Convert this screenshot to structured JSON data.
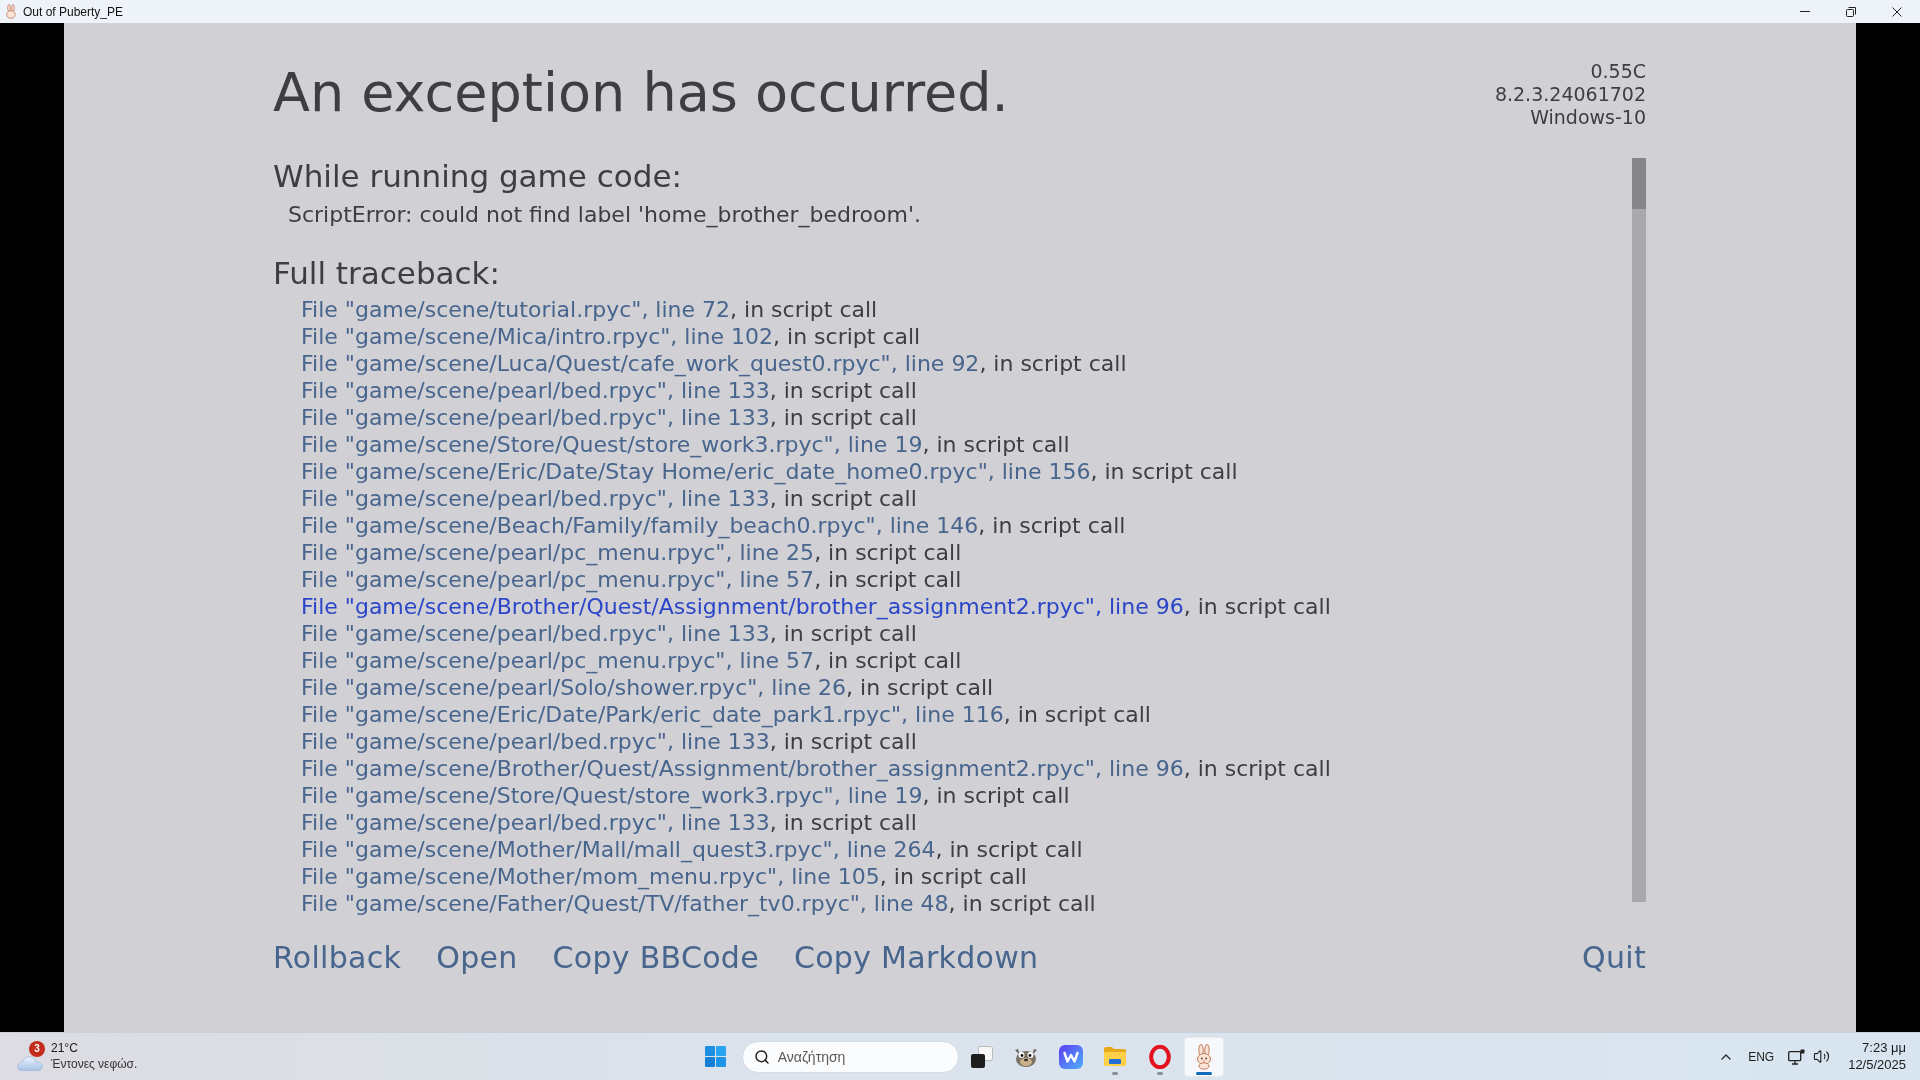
{
  "window": {
    "title": "Out of Puberty_PE"
  },
  "error_screen": {
    "title": "An exception has occurred.",
    "version_info": [
      "0.55C",
      "8.2.3.24061702",
      "Windows-10"
    ],
    "section_heading": "While running game code:",
    "error_message": "ScriptError: could not find label 'home_brother_bedroom'.",
    "traceback_heading": "Full traceback:",
    "traceback": [
      {
        "location": "File \"game/scene/tutorial.rpyc\", line 72",
        "context": ", in script call",
        "hovered": false
      },
      {
        "location": "File \"game/scene/Mica/intro.rpyc\", line 102",
        "context": ", in script call",
        "hovered": false
      },
      {
        "location": "File \"game/scene/Luca/Quest/cafe_work_quest0.rpyc\", line 92",
        "context": ", in script call",
        "hovered": false
      },
      {
        "location": "File \"game/scene/pearl/bed.rpyc\", line 133",
        "context": ", in script call",
        "hovered": false
      },
      {
        "location": "File \"game/scene/pearl/bed.rpyc\", line 133",
        "context": ", in script call",
        "hovered": false
      },
      {
        "location": "File \"game/scene/Store/Quest/store_work3.rpyc\", line 19",
        "context": ", in script call",
        "hovered": false
      },
      {
        "location": "File \"game/scene/Eric/Date/Stay Home/eric_date_home0.rpyc\", line 156",
        "context": ", in script call",
        "hovered": false
      },
      {
        "location": "File \"game/scene/pearl/bed.rpyc\", line 133",
        "context": ", in script call",
        "hovered": false
      },
      {
        "location": "File \"game/scene/Beach/Family/family_beach0.rpyc\", line 146",
        "context": ", in script call",
        "hovered": false
      },
      {
        "location": "File \"game/scene/pearl/pc_menu.rpyc\", line 25",
        "context": ", in script call",
        "hovered": false
      },
      {
        "location": "File \"game/scene/pearl/pc_menu.rpyc\", line 57",
        "context": ", in script call",
        "hovered": false
      },
      {
        "location": "File \"game/scene/Brother/Quest/Assignment/brother_assignment2.rpyc\", line 96",
        "context": ", in script call",
        "hovered": true
      },
      {
        "location": "File \"game/scene/pearl/bed.rpyc\", line 133",
        "context": ", in script call",
        "hovered": false
      },
      {
        "location": "File \"game/scene/pearl/pc_menu.rpyc\", line 57",
        "context": ", in script call",
        "hovered": false
      },
      {
        "location": "File \"game/scene/pearl/Solo/shower.rpyc\", line 26",
        "context": ", in script call",
        "hovered": false
      },
      {
        "location": "File \"game/scene/Eric/Date/Park/eric_date_park1.rpyc\", line 116",
        "context": ", in script call",
        "hovered": false
      },
      {
        "location": "File \"game/scene/pearl/bed.rpyc\", line 133",
        "context": ", in script call",
        "hovered": false
      },
      {
        "location": "File \"game/scene/Brother/Quest/Assignment/brother_assignment2.rpyc\", line 96",
        "context": ", in script call",
        "hovered": false
      },
      {
        "location": "File \"game/scene/Store/Quest/store_work3.rpyc\", line 19",
        "context": ", in script call",
        "hovered": false
      },
      {
        "location": "File \"game/scene/pearl/bed.rpyc\", line 133",
        "context": ", in script call",
        "hovered": false
      },
      {
        "location": "File \"game/scene/Mother/Mall/mall_quest3.rpyc\", line 264",
        "context": ", in script call",
        "hovered": false
      },
      {
        "location": "File \"game/scene/Mother/mom_menu.rpyc\", line 105",
        "context": ", in script call",
        "hovered": false
      },
      {
        "location": "File \"game/scene/Father/Quest/TV/father_tv0.rpyc\", line 48",
        "context": ", in script call",
        "hovered": false
      }
    ],
    "actions": [
      "Rollback",
      "Open",
      "Copy BBCode",
      "Copy Markdown"
    ],
    "quit": "Quit"
  },
  "taskbar": {
    "weather": {
      "badge": "3",
      "temperature": "21°C",
      "condition": "Έντονες νεφώσ."
    },
    "search": {
      "placeholder": "Αναζήτηση"
    },
    "apps": [
      {
        "kind": "squares",
        "running": false,
        "selected": false
      },
      {
        "kind": "creature",
        "running": false,
        "selected": false
      },
      {
        "kind": "zigzag",
        "running": false,
        "selected": false
      },
      {
        "kind": "folder",
        "running": true,
        "selected": false
      },
      {
        "kind": "ring",
        "running": true,
        "selected": false
      },
      {
        "kind": "rabbit",
        "running": true,
        "selected": true
      }
    ],
    "tray": {
      "language": "ENG",
      "time": "7:23 μμ",
      "date": "12/5/2025"
    }
  }
}
